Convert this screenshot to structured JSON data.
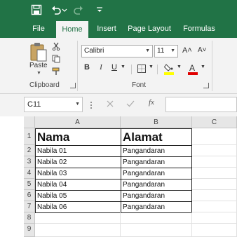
{
  "quick_access": {
    "save_icon": "save-icon",
    "undo_icon": "undo-icon",
    "redo_icon": "redo-icon",
    "customize_icon": "customize-qat-icon"
  },
  "tabs": [
    {
      "label": "File",
      "active": false
    },
    {
      "label": "Home",
      "active": true
    },
    {
      "label": "Insert",
      "active": false
    },
    {
      "label": "Page Layout",
      "active": false
    },
    {
      "label": "Formulas",
      "active": false
    }
  ],
  "ribbon": {
    "clipboard": {
      "group_label": "Clipboard",
      "paste_label": "Paste"
    },
    "font": {
      "group_label": "Font",
      "font_name": "Calibri",
      "font_size": "11",
      "bold_label": "B",
      "italic_label": "I",
      "underline_label": "U",
      "grow_label": "A˄",
      "shrink_label": "A˅",
      "fill_color": "#ffff00",
      "font_color": "#e00000"
    }
  },
  "formula_bar": {
    "name_box": "C11",
    "fx_label": "fx",
    "formula": ""
  },
  "sheet": {
    "columns": [
      "A",
      "B",
      "C"
    ],
    "rows": [
      "1",
      "2",
      "3",
      "4",
      "5",
      "6",
      "7",
      "8",
      "9"
    ],
    "headers": [
      "Nama",
      "Alamat"
    ],
    "data": [
      [
        "Nabila 01",
        "Pangandaran"
      ],
      [
        "Nabila 02",
        "Pangandaran"
      ],
      [
        "Nabila 03",
        "Pangandaran"
      ],
      [
        "Nabila 04",
        "Pangandaran"
      ],
      [
        "Nabila 05",
        "Pangandaran"
      ],
      [
        "Nabila 06",
        "Pangandaran"
      ]
    ]
  },
  "colors": {
    "accent": "#217346",
    "ribbon_bg": "#f3f3f3",
    "header_bg": "#e6e6e6"
  }
}
